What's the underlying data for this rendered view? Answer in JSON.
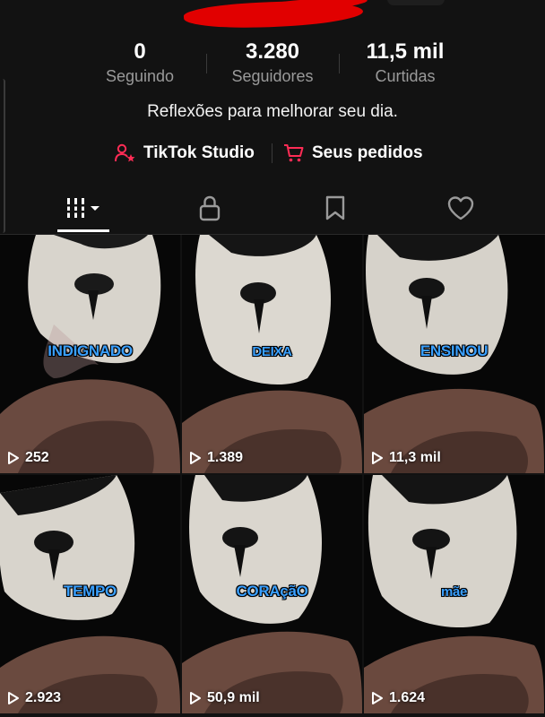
{
  "stats": [
    {
      "value": "0",
      "label": "Seguindo"
    },
    {
      "value": "3.280",
      "label": "Seguidores"
    },
    {
      "value": "11,5 mil",
      "label": "Curtidas"
    }
  ],
  "bio": "Reflexões para melhorar seu dia.",
  "links": {
    "studio": "TikTok Studio",
    "orders": "Seus pedidos"
  },
  "tabs": [
    "videos-grid-icon",
    "lock-icon",
    "bookmark-icon",
    "heart-icon"
  ],
  "colors": {
    "background": "#121212",
    "caption_blue": "#3aa0ff",
    "accent_red": "#fe2c55",
    "muted_text": "#9a9a9a"
  },
  "videos": [
    {
      "caption": "INDIGNADO",
      "views": "252"
    },
    {
      "caption": "DEIXA",
      "views": "1.389"
    },
    {
      "caption": "ENSINOU",
      "views": "11,3 mil"
    },
    {
      "caption": "TEMPO",
      "views": "2.923"
    },
    {
      "caption": "CORAçãO",
      "views": "50,9 mil"
    },
    {
      "caption": "mãe",
      "views": "1.624"
    }
  ]
}
